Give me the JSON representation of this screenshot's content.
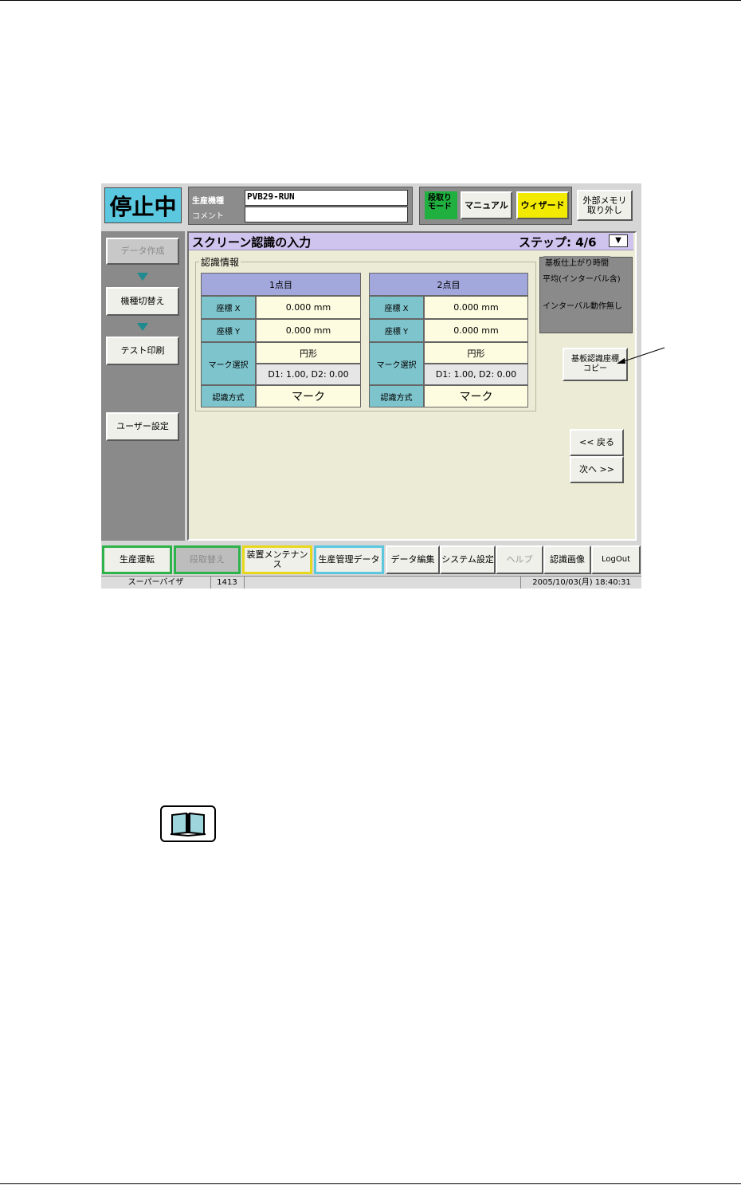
{
  "header": {
    "status": "停止中",
    "product_label": "生産機種",
    "product_value": "PVB29-RUN",
    "comment_label": "コメント",
    "comment_value": ""
  },
  "mode": {
    "label": "段取り\nモード",
    "manual": "マニュアル",
    "wizard": "ウィザード",
    "external_memory": "外部メモリ\n取り外し"
  },
  "sidebar": {
    "items": [
      "データ作成",
      "機種切替え",
      "テスト印刷",
      "ユーザー設定"
    ]
  },
  "page": {
    "title": "スクリーン認識の入力",
    "step": "ステップ: 4/6",
    "group_title": "認識情報",
    "points": [
      {
        "header": "1点目",
        "coord_x_label": "座標 X",
        "coord_x": "0.000 mm",
        "coord_y_label": "座標 Y",
        "coord_y": "0.000 mm",
        "mark_select_label": "マーク選択",
        "mark_shape": "円形",
        "mark_dims": "D1: 1.00, D2: 0.00",
        "method_label": "認識方式",
        "method": "マーク"
      },
      {
        "header": "2点目",
        "coord_x_label": "座標 X",
        "coord_x": "0.000 mm",
        "coord_y_label": "座標 Y",
        "coord_y": "0.000 mm",
        "mark_select_label": "マーク選択",
        "mark_shape": "円形",
        "mark_dims": "D1: 1.00, D2: 0.00",
        "method_label": "認識方式",
        "method": "マーク"
      }
    ],
    "time_box": {
      "title": "基板仕上がり時間",
      "line1": "平均(インターバル含)",
      "line2": "インターバル動作無し"
    },
    "copy_button": "基板認識座標\nコピー",
    "back_button": "<< 戻る",
    "next_button": "次へ >>"
  },
  "bottom": {
    "buttons": [
      "生産運転",
      "段取替え",
      "装置メンテナンス",
      "生産管理データ",
      "データ編集",
      "システム設定",
      "ヘルプ",
      "認識画像",
      "LogOut"
    ]
  },
  "statusbar": {
    "user": "スーパーバイザ",
    "code": "1413",
    "datetime": "2005/10/03(月) 18:40:31"
  }
}
